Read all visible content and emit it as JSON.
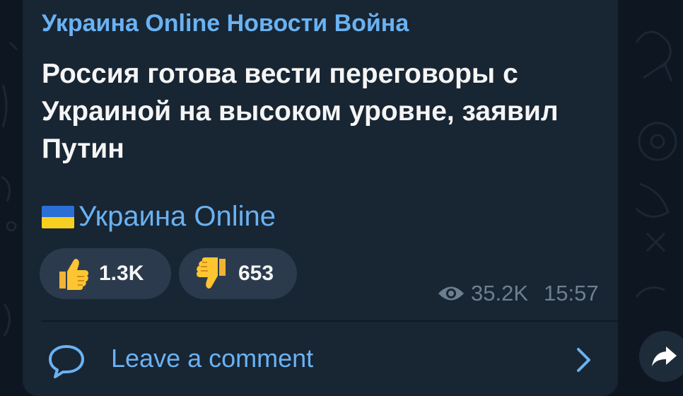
{
  "post": {
    "channel_name": "Украина Online Новости Война",
    "text_lines": [
      "Россия готова вести переговоры с",
      "Украиной на высоком уровне, заявил",
      "Путин"
    ],
    "signature": "Украина Online"
  },
  "reactions": [
    {
      "icon": "thumbs-up-icon",
      "count": "1.3K"
    },
    {
      "icon": "thumbs-down-icon",
      "count": "653"
    }
  ],
  "meta": {
    "views": "35.2K",
    "time": "15:57"
  },
  "comments": {
    "label": "Leave a comment"
  },
  "colors": {
    "background": "#0e1621",
    "bubble": "#182533",
    "accent": "#6ab2f2",
    "reaction_bg": "#2b3b4d",
    "meta_text": "#6d7f8f"
  }
}
